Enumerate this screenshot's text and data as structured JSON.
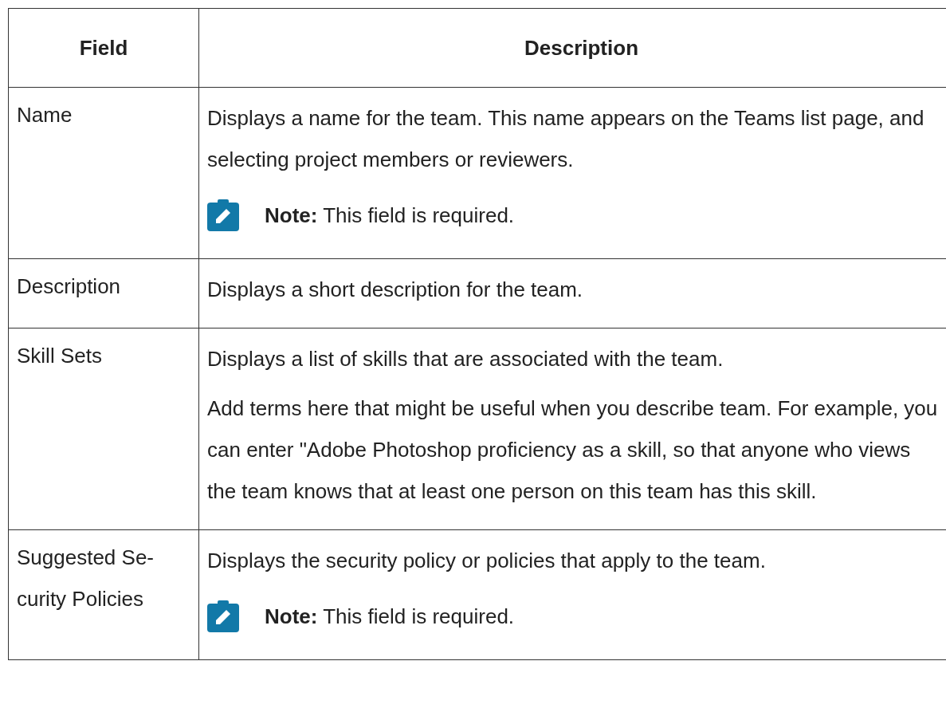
{
  "table": {
    "columns": [
      "Field",
      "Description"
    ],
    "rows": [
      {
        "field": "Name",
        "paragraphs": [
          "Displays a name for the team. This name appears on the Teams list page, and selecting project members or reviewers."
        ],
        "note": "**Note:** This field is required."
      },
      {
        "field": "Description",
        "paragraphs": [
          "Displays a short description for the team."
        ]
      },
      {
        "field": "Skill Sets",
        "paragraphs": [
          "Displays a list of skills that are associated with the team.",
          "Add terms here that might be useful when you describe team. For example, you can enter \"Adobe Photoshop proficiency as a skill, so that anyone who views the team knows that at least one person on this team has this skill."
        ]
      },
      {
        "field": "Suggested Se-curity Policies",
        "paragraphs": [
          "Displays the security policy or policies that apply to the team."
        ],
        "note": "**Note:** This field is required."
      }
    ]
  }
}
